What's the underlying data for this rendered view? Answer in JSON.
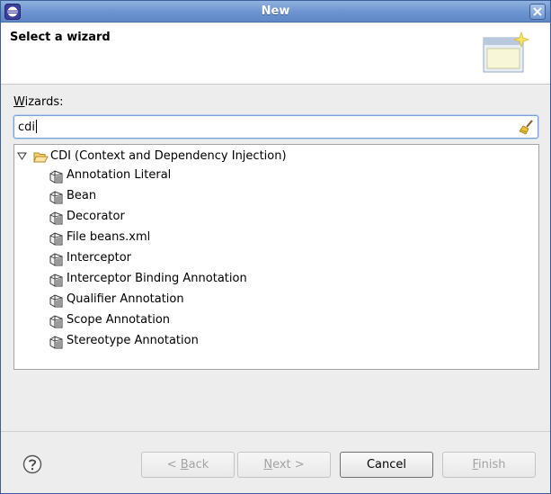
{
  "window": {
    "title": "New"
  },
  "banner": {
    "title": "Select a wizard"
  },
  "wizards": {
    "label_mnemonic": "W",
    "label_rest": "izards:",
    "filter_value": "cdi"
  },
  "tree": {
    "root_label": "CDI (Context and Dependency Injection)",
    "items": [
      "Annotation Literal",
      "Bean",
      "Decorator",
      "File beans.xml",
      "Interceptor",
      "Interceptor Binding Annotation",
      "Qualifier Annotation",
      "Scope Annotation",
      "Stereotype Annotation"
    ]
  },
  "buttons": {
    "back_mnemonic": "B",
    "back_prefix": "< ",
    "back_rest": "ack",
    "next_mnemonic": "N",
    "next_rest": "ext >",
    "cancel": "Cancel",
    "finish_mnemonic": "F",
    "finish_rest": "inish"
  },
  "colors": {
    "titlebar": "#6b93cf",
    "window_bg": "#ededed",
    "focus_border": "#7aa2d6"
  }
}
